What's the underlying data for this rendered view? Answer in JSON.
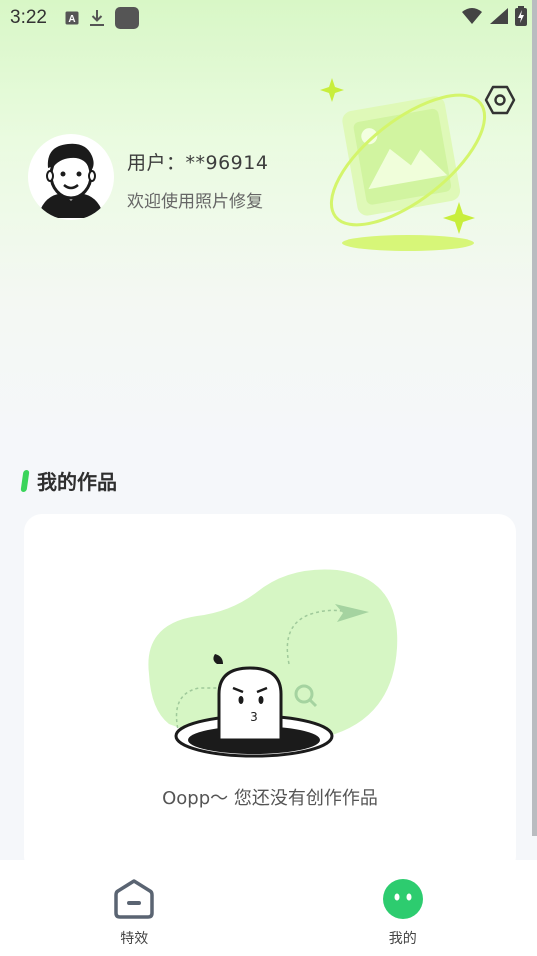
{
  "status_bar": {
    "time": "3:22",
    "icons": [
      "a-notification-icon",
      "download-icon",
      "app-square-icon"
    ],
    "right_icons": [
      "wifi-icon",
      "signal-icon",
      "battery-charging-icon"
    ]
  },
  "profile": {
    "user_label": "用户：**96914",
    "welcome": "欢迎使用照片修复",
    "avatar_icon": "cartoon-avatar-icon",
    "settings_icon": "settings-hex-icon"
  },
  "works": {
    "title": "我的作品",
    "empty_text": "Oopp〜 您还没有创作作品",
    "illustration_icon": "empty-hole-character-icon"
  },
  "nav": {
    "items": [
      {
        "label": "特效",
        "icon": "home-icon",
        "active": false
      },
      {
        "label": "我的",
        "icon": "smiley-face-icon",
        "active": true
      }
    ]
  },
  "colors": {
    "accent": "#3ad45a",
    "active_nav": "#2dcc6f",
    "lime": "#d4f56b"
  }
}
